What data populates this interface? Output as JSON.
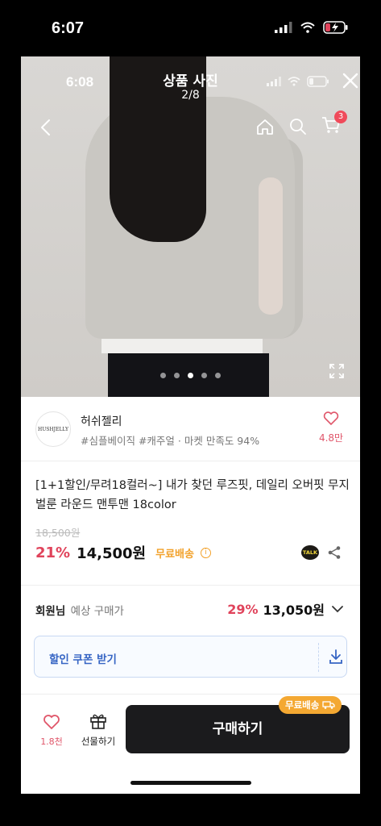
{
  "outer_status": {
    "time": "6:07",
    "battery_color": "#e0435b"
  },
  "inner_status": {
    "time": "6:08"
  },
  "photo_viewer": {
    "title": "상품 사진",
    "counter": "2/8",
    "dots_total": 5,
    "dots_active_index": 2,
    "cart_count": "3"
  },
  "shop": {
    "logo_text": "HUSHJELLY",
    "name": "허쉬젤리",
    "tags": "#심플베이직 #캐주얼 · 마켓 만족도 94%",
    "like_count": "4.8만"
  },
  "product": {
    "title": "[1+1할인/무려18컬러~] 내가 찾던 루즈핏, 데일리 오버핏 무지 벌룬 라운드 맨투맨 18color",
    "original_price": "18,500원",
    "discount": "21%",
    "price": "14,500원",
    "free_shipping": "무료배송",
    "talk_label": "TALK"
  },
  "member": {
    "label": "회원님",
    "sub": "예상 구매가",
    "discount": "29%",
    "price": "13,050원"
  },
  "coupon": {
    "label": "할인 쿠폰 받기"
  },
  "bottom_bar": {
    "wish_count": "1.8천",
    "gift_label": "선물하기",
    "buy_label": "구매하기",
    "buy_badge": "무료배송"
  },
  "colors": {
    "accent_red": "#e0435b",
    "accent_orange": "#f2a12a",
    "coupon_blue": "#3665c4",
    "buy_button": "#1b1b1d"
  }
}
